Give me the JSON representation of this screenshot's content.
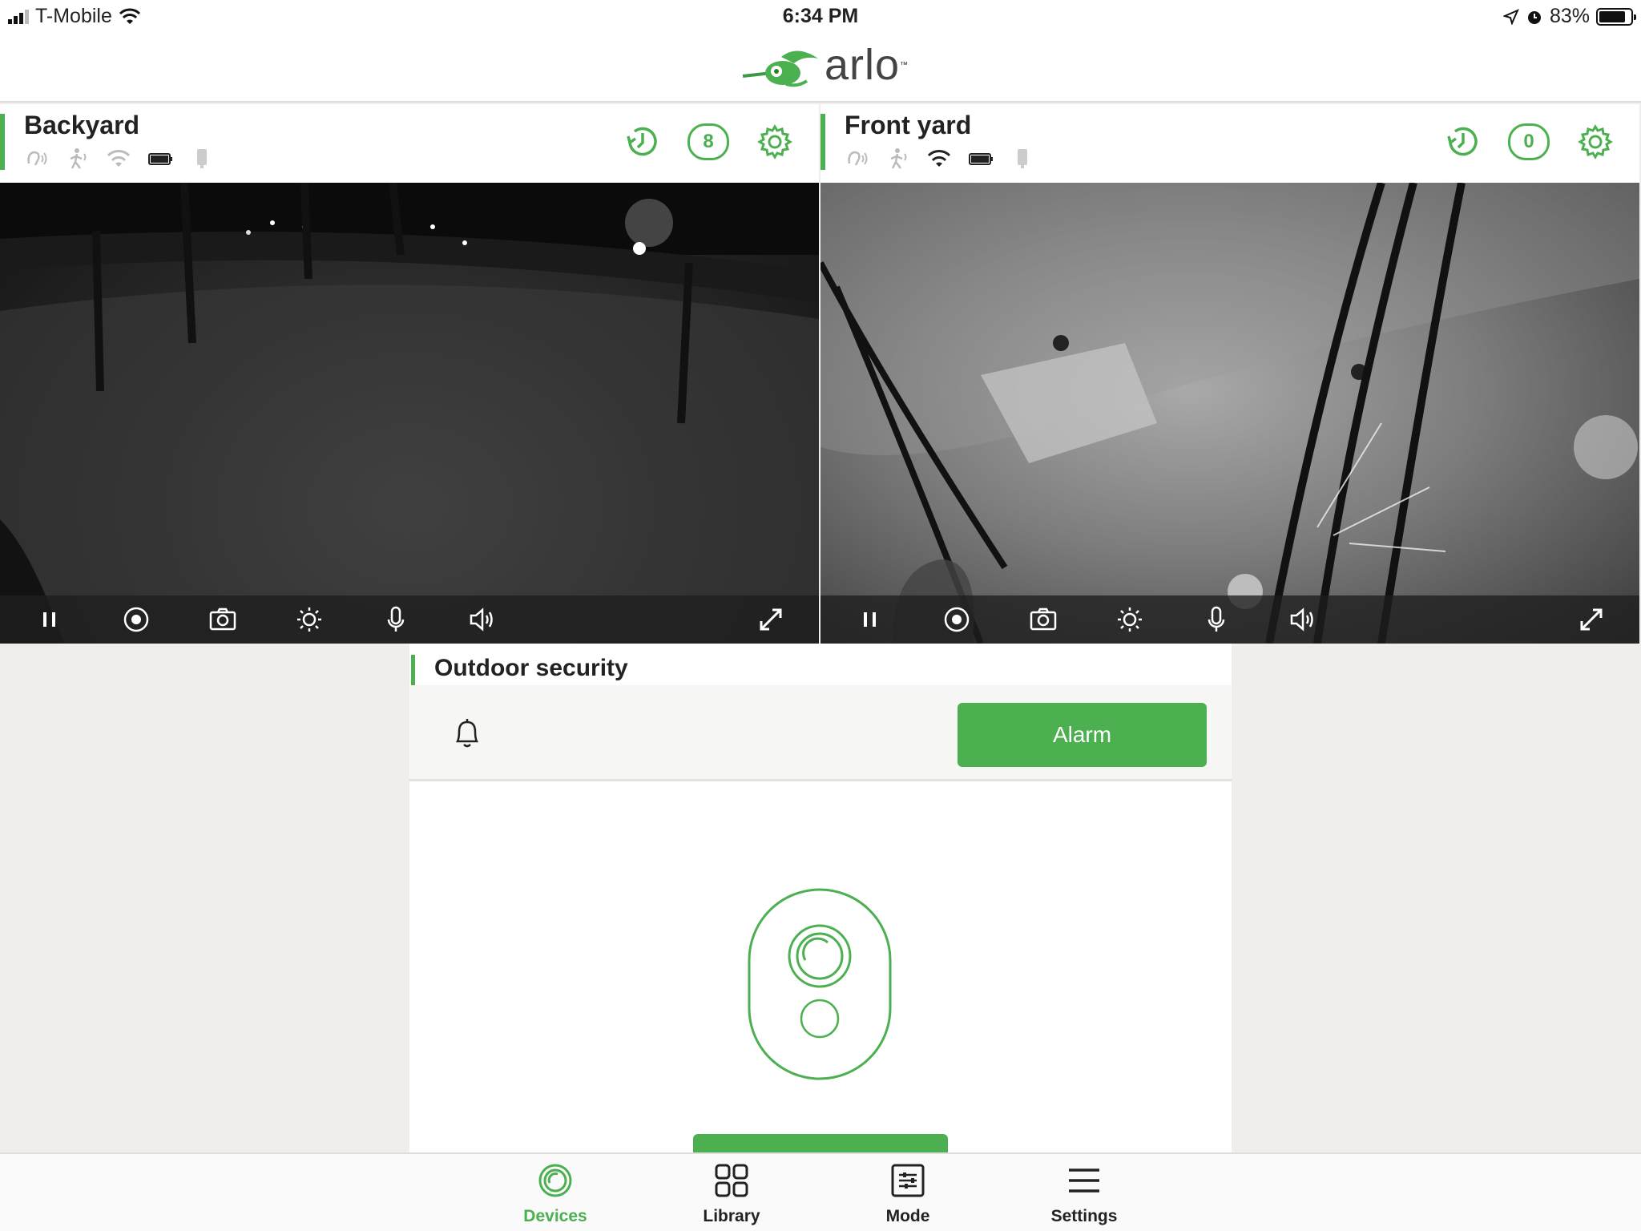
{
  "status_bar": {
    "carrier": "T-Mobile",
    "time": "6:34 PM",
    "battery_percent": "83%",
    "battery_level": 0.83
  },
  "header": {
    "logo_text": "arlo",
    "logo_mark": "™"
  },
  "cameras": [
    {
      "name": "Backyard",
      "clip_count": "8",
      "status_icons": [
        "audio-detection-icon",
        "motion-detection-icon",
        "wifi-icon",
        "battery-icon",
        "signal-icon"
      ],
      "feed_style": "night-dark"
    },
    {
      "name": "Front yard",
      "clip_count": "0",
      "status_icons": [
        "audio-detection-icon",
        "motion-detection-icon",
        "wifi-icon",
        "battery-icon",
        "signal-icon"
      ],
      "feed_style": "night-bright"
    }
  ],
  "camera_controls": [
    "pause-icon",
    "record-icon",
    "snapshot-icon",
    "brightness-icon",
    "microphone-icon",
    "speaker-icon",
    "fullscreen-icon"
  ],
  "security": {
    "title": "Outdoor security",
    "alarm_label": "Alarm"
  },
  "tabs": [
    {
      "label": "Devices",
      "icon": "devices-icon",
      "active": true
    },
    {
      "label": "Library",
      "icon": "library-icon",
      "active": false
    },
    {
      "label": "Mode",
      "icon": "mode-icon",
      "active": false
    },
    {
      "label": "Settings",
      "icon": "settings-menu-icon",
      "active": false
    }
  ],
  "colors": {
    "accent": "#4caf50",
    "background": "#efeeec"
  }
}
